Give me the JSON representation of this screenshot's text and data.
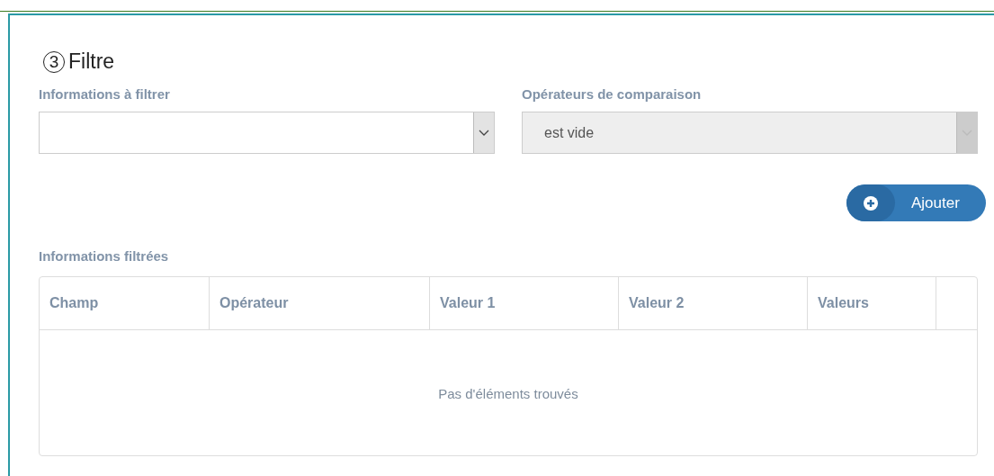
{
  "section": {
    "step": "3",
    "title": "Filtre"
  },
  "fields": [
    {
      "label": "Informations à filtrer",
      "disabled": false
    },
    {
      "label": "Opérateurs de comparaison",
      "value": "est vide",
      "disabled": true
    }
  ],
  "add_button": {
    "label": "Ajouter"
  },
  "table": {
    "label": "Informations filtrées",
    "columns": [
      "Champ",
      "Opérateur",
      "Valeur 1",
      "Valeur 2",
      "Valeurs"
    ],
    "empty_message": "Pas d'éléments trouvés"
  }
}
